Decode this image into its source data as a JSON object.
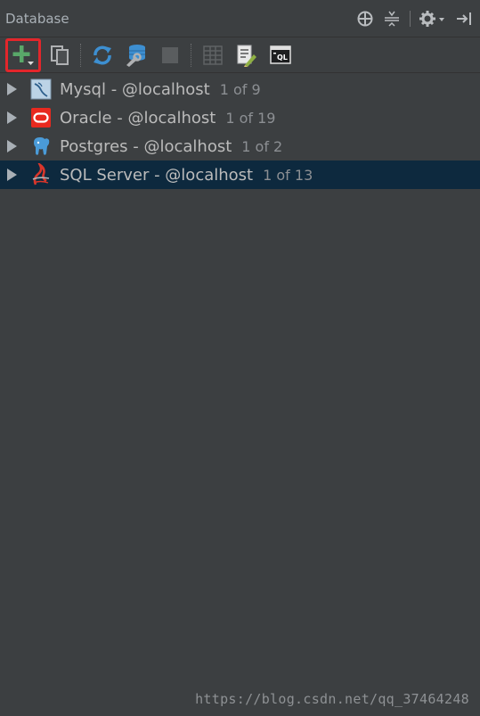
{
  "header": {
    "title": "Database",
    "tools": [
      "crosshair-icon",
      "collapse-icon",
      "gear-icon",
      "hide-icon"
    ]
  },
  "toolbar": {
    "buttons": [
      "add-icon",
      "copy-icon",
      "refresh-icon",
      "properties-icon",
      "stop-icon",
      "table-icon",
      "edit-icon",
      "sql-console-icon"
    ],
    "sql_badge": "QL",
    "highlight_color": "#e3262b"
  },
  "tree": {
    "items": [
      {
        "label": "Mysql - @localhost",
        "count": "1 of 9",
        "icon": "mysql-icon",
        "selected": false
      },
      {
        "label": "Oracle - @localhost",
        "count": "1 of 19",
        "icon": "oracle-icon",
        "selected": false
      },
      {
        "label": "Postgres - @localhost",
        "count": "1 of 2",
        "icon": "postgres-icon",
        "selected": false
      },
      {
        "label": "SQL Server - @localhost",
        "count": "1 of 13",
        "icon": "sqlserver-icon",
        "selected": true
      }
    ]
  },
  "watermark": "https://blog.csdn.net/qq_37464248",
  "colors": {
    "panel_bg": "#3c3f41",
    "selected_row": "#0d293e",
    "text": "#bbbbbb",
    "secondary_text": "#8c8f93"
  }
}
